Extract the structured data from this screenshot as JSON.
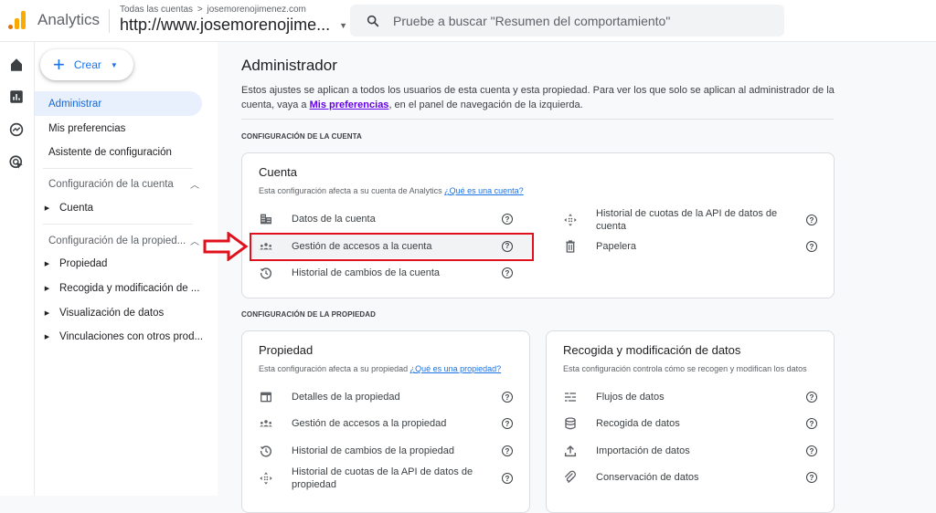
{
  "header": {
    "app_name": "Analytics",
    "breadcrumb_root": "Todas las cuentas",
    "breadcrumb_sep": ">",
    "breadcrumb_account": "josemorenojimenez.com",
    "property_selector": "http://www.josemorenojime...",
    "search_placeholder": "Pruebe a buscar \"Resumen del comportamiento\""
  },
  "rail": {
    "icons": [
      "home-icon",
      "reports-icon",
      "explore-icon",
      "advertising-icon"
    ]
  },
  "sidenav": {
    "create_label": "Crear",
    "items": [
      {
        "label": "Administrar",
        "active": true
      },
      {
        "label": "Mis preferencias",
        "active": false
      },
      {
        "label": "Asistente de configuración",
        "active": false
      }
    ],
    "account_section": {
      "label": "Configuración de la cuenta",
      "children": [
        "Cuenta"
      ]
    },
    "property_section": {
      "label": "Configuración de la propied...",
      "children": [
        "Propiedad",
        "Recogida y modificación de ...",
        "Visualización de datos",
        "Vinculaciones con otros prod..."
      ]
    }
  },
  "main": {
    "title": "Administrador",
    "intro_part1": "Estos ajustes se aplican a todos los usuarios de esta cuenta y esta propiedad. Para ver los que solo se aplican al administrador de la cuenta, vaya a ",
    "intro_link": "Mis preferencias",
    "intro_part2": ", en el panel de navegación de la izquierda.",
    "account_section_label": "CONFIGURACIÓN DE LA CUENTA",
    "property_section_label": "CONFIGURACIÓN DE LA PROPIEDAD",
    "account_card": {
      "title": "Cuenta",
      "subtitle": "Esta configuración afecta a su cuenta de Analytics ",
      "subtitle_link": "¿Qué es una cuenta?",
      "left_rows": [
        {
          "label": "Datos de la cuenta",
          "icon": "building-icon"
        },
        {
          "label": "Gestión de accesos a la cuenta",
          "icon": "people-icon",
          "highlighted": true
        },
        {
          "label": "Historial de cambios de la cuenta",
          "icon": "history-icon"
        }
      ],
      "right_rows": [
        {
          "label": "Historial de cuotas de la API de datos de cuenta",
          "icon": "api-quota-icon"
        },
        {
          "label": "Papelera",
          "icon": "trash-icon"
        }
      ]
    },
    "property_card": {
      "title": "Propiedad",
      "subtitle": "Esta configuración afecta a su propiedad ",
      "subtitle_link": "¿Qué es una propiedad?",
      "rows": [
        {
          "label": "Detalles de la propiedad",
          "icon": "property-details-icon"
        },
        {
          "label": "Gestión de accesos a la propiedad",
          "icon": "people-icon"
        },
        {
          "label": "Historial de cambios de la propiedad",
          "icon": "history-icon"
        },
        {
          "label": "Historial de cuotas de la API de datos de propiedad",
          "icon": "api-quota-icon"
        }
      ]
    },
    "data_card": {
      "title": "Recogida y modificación de datos",
      "subtitle": "Esta configuración controla cómo se recogen y modifican los datos",
      "rows": [
        {
          "label": "Flujos de datos",
          "icon": "data-streams-icon"
        },
        {
          "label": "Recogida de datos",
          "icon": "database-icon"
        },
        {
          "label": "Importación de datos",
          "icon": "upload-icon"
        },
        {
          "label": "Conservación de datos",
          "icon": "retention-icon"
        }
      ]
    },
    "help_glyph": "?"
  },
  "colors": {
    "accent": "#1a73e8",
    "annotation_red": "#e0101c",
    "link_purple": "#6200ea"
  }
}
